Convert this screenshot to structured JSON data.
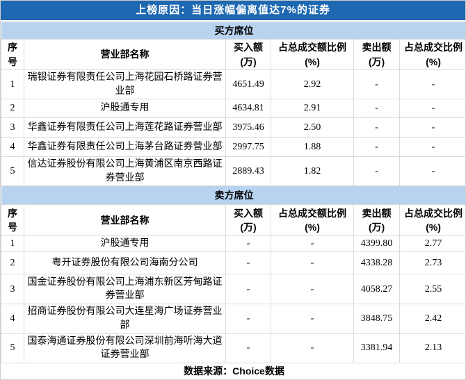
{
  "colors": {
    "title_bar_bg": "#1e68b2",
    "title_text": "#ffffff",
    "section_bar_bg": "#b8d3f0",
    "border": "#d9d9d9",
    "body_text": "#000000"
  },
  "chart_data": {
    "type": "table",
    "title": "上榜原因：当日涨幅偏离值达7%的证券",
    "columns": [
      "序号",
      "营业部名称",
      "买入额(万)",
      "占总成交额比例(%)",
      "卖出额(万)",
      "占总成交比例(%)"
    ],
    "sections": [
      {
        "name": "买方席位",
        "rows": [
          {
            "no": "1",
            "name": "瑞银证券有限责任公司上海花园石桥路证券营业部",
            "buy": "4651.49",
            "buy_ratio": "2.92",
            "sell": "-",
            "sell_ratio": "-"
          },
          {
            "no": "2",
            "name": "沪股通专用",
            "buy": "4634.81",
            "buy_ratio": "2.91",
            "sell": "-",
            "sell_ratio": "-"
          },
          {
            "no": "3",
            "name": "华鑫证券有限责任公司上海莲花路证券营业部",
            "buy": "3975.46",
            "buy_ratio": "2.50",
            "sell": "-",
            "sell_ratio": "-"
          },
          {
            "no": "4",
            "name": "华鑫证券有限责任公司上海茅台路证券营业部",
            "buy": "2997.75",
            "buy_ratio": "1.88",
            "sell": "-",
            "sell_ratio": "-"
          },
          {
            "no": "5",
            "name": "信达证券股份有限公司上海黄浦区南京西路证券营业部",
            "buy": "2889.43",
            "buy_ratio": "1.82",
            "sell": "-",
            "sell_ratio": "-"
          }
        ]
      },
      {
        "name": "卖方席位",
        "rows": [
          {
            "no": "1",
            "name": "沪股通专用",
            "buy": "-",
            "buy_ratio": "-",
            "sell": "4399.80",
            "sell_ratio": "2.77"
          },
          {
            "no": "2",
            "name": "粤开证券股份有限公司海南分公司",
            "buy": "-",
            "buy_ratio": "-",
            "sell": "4338.28",
            "sell_ratio": "2.73"
          },
          {
            "no": "3",
            "name": "国金证券股份有限公司上海浦东新区芳甸路证券营业部",
            "buy": "-",
            "buy_ratio": "-",
            "sell": "4058.27",
            "sell_ratio": "2.55"
          },
          {
            "no": "4",
            "name": "招商证券股份有限公司大连星海广场证券营业部",
            "buy": "-",
            "buy_ratio": "-",
            "sell": "3848.75",
            "sell_ratio": "2.42"
          },
          {
            "no": "5",
            "name": "国泰海通证券股份有限公司深圳前海听海大道证券营业部",
            "buy": "-",
            "buy_ratio": "-",
            "sell": "3381.94",
            "sell_ratio": "2.13"
          }
        ]
      }
    ],
    "source": "数据来源：Choice数据",
    "layout": {
      "grid": true,
      "header_rows_per_section": true
    }
  }
}
